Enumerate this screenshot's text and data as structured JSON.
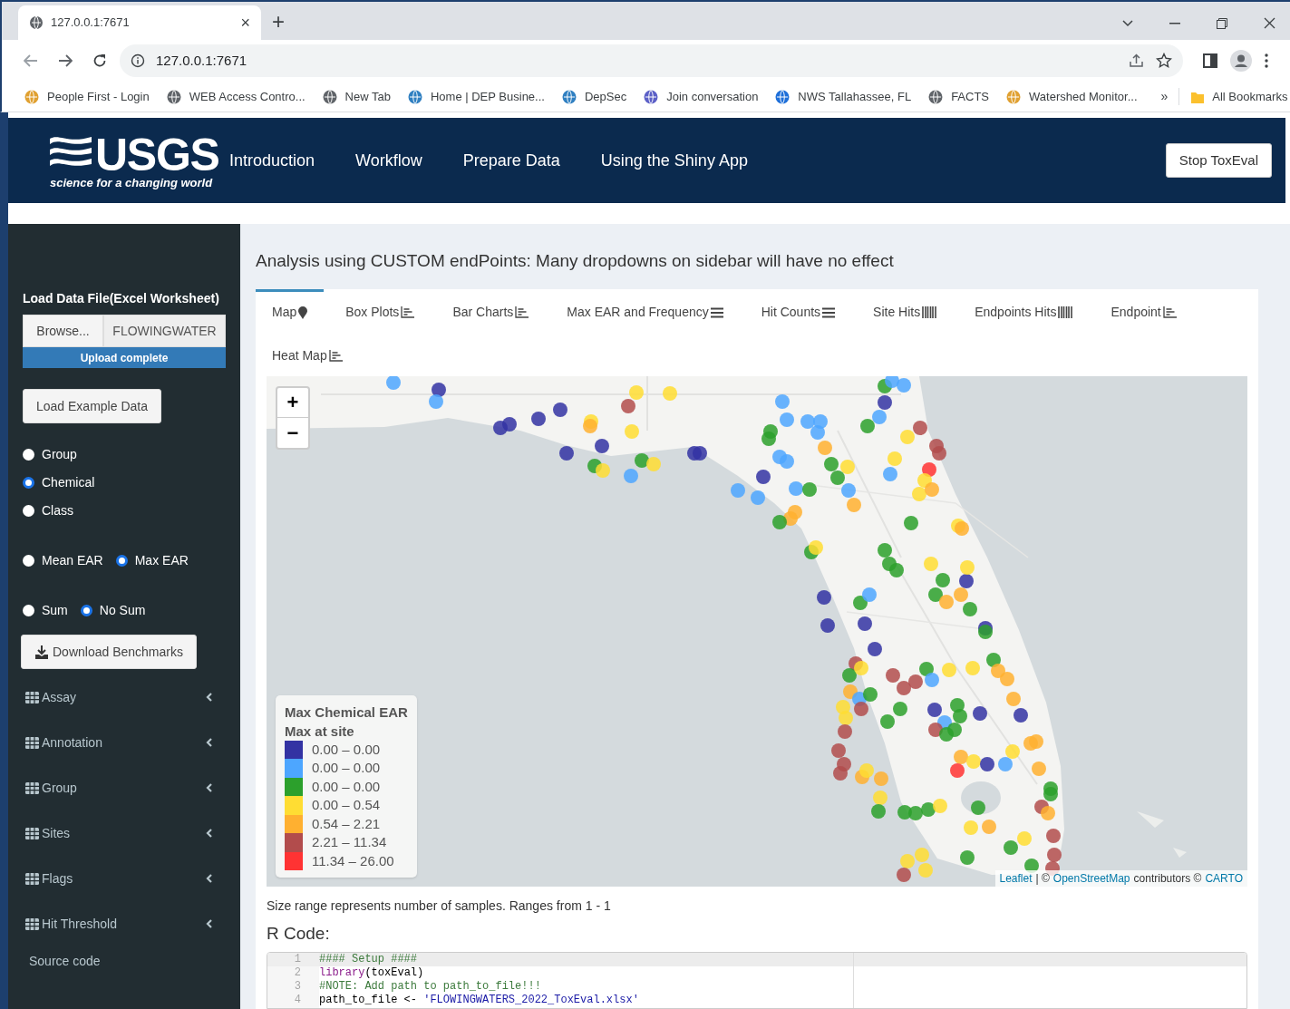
{
  "browser": {
    "tab": {
      "title": "127.0.0.1:7671",
      "close": "×"
    },
    "new_tab": "+",
    "address": "127.0.0.1:7671",
    "bookmarks": [
      {
        "label": "People First - Login",
        "color": "#e0a030"
      },
      {
        "label": "WEB Access Contro...",
        "color": "#5f6368"
      },
      {
        "label": "New Tab",
        "color": "#5f6368"
      },
      {
        "label": "Home | DEP Busine...",
        "color": "#2f7fc1"
      },
      {
        "label": "DepSec",
        "color": "#2f7fc1"
      },
      {
        "label": "Join conversation",
        "color": "#5b5fc7"
      },
      {
        "label": "NWS Tallahassee, FL",
        "color": "#1e6fd9"
      },
      {
        "label": "FACTS",
        "color": "#5f6368"
      },
      {
        "label": "Watershed Monitor...",
        "color": "#e0a030"
      }
    ],
    "more": "»",
    "all_bookmarks": "All Bookmarks"
  },
  "navbar": {
    "logo": {
      "name": "USGS",
      "tagline": "science for a changing world"
    },
    "items": [
      "Introduction",
      "Workflow",
      "Prepare Data",
      "Using the Shiny App"
    ],
    "stop_button": "Stop ToxEval"
  },
  "sidebar": {
    "file_label": "Load Data File(Excel Worksheet)",
    "browse": "Browse...",
    "file_name": "FLOWINGWATER",
    "upload": {
      "status": "Upload complete",
      "level": 1
    },
    "example_button": "Load Example Data",
    "radio_groups": [
      [
        {
          "label": "Group",
          "selected": false
        },
        {
          "label": "Chemical",
          "selected": true
        },
        {
          "label": "Class",
          "selected": false
        }
      ],
      [
        {
          "label": "Mean EAR",
          "selected": false
        },
        {
          "label": "Max EAR",
          "selected": true
        }
      ],
      [
        {
          "label": "Sum",
          "selected": false
        },
        {
          "label": "No Sum",
          "selected": true
        }
      ]
    ],
    "download_button": "Download Benchmarks",
    "menu": [
      {
        "label": "Assay",
        "expanded": false
      },
      {
        "label": "Annotation",
        "expanded": false
      },
      {
        "label": "Group",
        "expanded": false
      },
      {
        "label": "Sites",
        "expanded": false
      },
      {
        "label": "Flags",
        "expanded": false
      },
      {
        "label": "Hit Threshold",
        "expanded": false
      }
    ],
    "source_link": "Source code"
  },
  "main": {
    "heading": "Analysis using CUSTOM endPoints: Many dropdowns on sidebar will have no effect",
    "tabs": [
      {
        "label": "Map",
        "kind": "marker",
        "selected": true
      },
      {
        "label": "Box Plots",
        "kind": "chart",
        "selected": false
      },
      {
        "label": "Bar Charts",
        "kind": "chart",
        "selected": false
      },
      {
        "label": "Max EAR and Frequency",
        "kind": "list",
        "selected": false
      },
      {
        "label": "Hit Counts",
        "kind": "list",
        "selected": false
      },
      {
        "label": "Site Hits",
        "kind": "barcode",
        "selected": false
      },
      {
        "label": "Endpoints Hits",
        "kind": "barcode",
        "selected": false
      },
      {
        "label": "Endpoint",
        "kind": "chart",
        "selected": false
      },
      {
        "label": "Heat Map",
        "kind": "chart",
        "selected": false
      }
    ],
    "map": {
      "zoom_in": "+",
      "zoom_out": "−",
      "legend": {
        "title": "Max Chemical EAR",
        "subtitle": "Max at site",
        "items": [
          {
            "label": "0.00 – 0.00",
            "color": "#3333a3"
          },
          {
            "label": "0.00 – 0.00",
            "color": "#4da6ff"
          },
          {
            "label": "0.00 – 0.00",
            "color": "#2ca02c"
          },
          {
            "label": "0.00 – 0.54",
            "color": "#ffdd33"
          },
          {
            "label": "0.54 – 2.21",
            "color": "#ffb030"
          },
          {
            "label": "2.21 – 11.34",
            "color": "#b24c4c"
          },
          {
            "label": "11.34 – 26.00",
            "color": "#ff3333"
          }
        ]
      },
      "attribution": {
        "leaflet": "Leaflet",
        "sep": "| ©",
        "osm": "OpenStreetMap",
        "contrib": "contributors ©",
        "carto": "CARTO"
      }
    },
    "size_note": "Size range represents number of samples. Ranges from 1 - 1",
    "code_heading": "R Code:",
    "code": [
      {
        "number": "1",
        "tokens": [
          {
            "kind": "comment",
            "text": "#### Setup ####"
          }
        ]
      },
      {
        "number": "2",
        "tokens": [
          {
            "kind": "function",
            "text": "library"
          },
          {
            "kind": "plain",
            "text": "(toxEval)"
          }
        ]
      },
      {
        "number": "3",
        "tokens": [
          {
            "kind": "comment",
            "text": "#NOTE: Add path to path_to_file!!!"
          }
        ]
      },
      {
        "number": "4",
        "tokens": [
          {
            "kind": "plain",
            "text": "path_to_file <- "
          },
          {
            "kind": "string",
            "text": "'FLOWINGWATERS_2022_ToxEval.xlsx'"
          }
        ]
      }
    ]
  }
}
